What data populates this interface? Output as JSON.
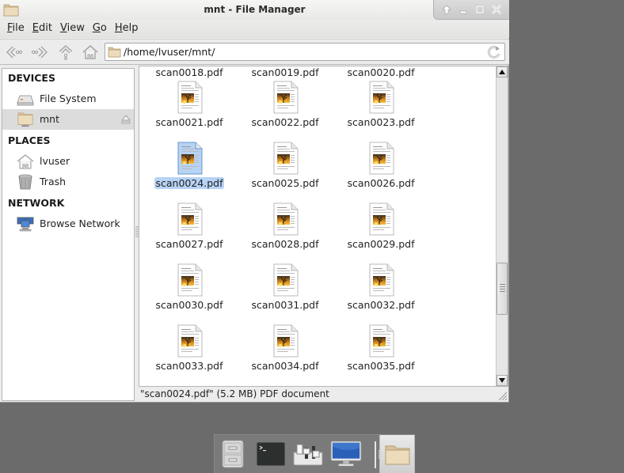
{
  "window": {
    "title": "mnt - File Manager",
    "controls": [
      "roll-up",
      "minimize",
      "maximize",
      "close"
    ]
  },
  "menubar": [
    {
      "label": "File",
      "mnemonic": "F",
      "rest": "ile"
    },
    {
      "label": "Edit",
      "mnemonic": "E",
      "rest": "dit"
    },
    {
      "label": "View",
      "mnemonic": "V",
      "rest": "iew"
    },
    {
      "label": "Go",
      "mnemonic": "G",
      "rest": "o"
    },
    {
      "label": "Help",
      "mnemonic": "H",
      "rest": "elp"
    }
  ],
  "toolbar": {
    "buttons": [
      "back",
      "forward",
      "up",
      "home"
    ],
    "location": "/home/lvuser/mnt/"
  },
  "sidebar": {
    "sections": [
      {
        "heading": "DEVICES",
        "items": [
          {
            "label": "File System",
            "icon": "harddisk-icon"
          },
          {
            "label": "mnt",
            "icon": "mounted-folder-icon",
            "selected": true,
            "eject": true
          }
        ]
      },
      {
        "heading": "PLACES",
        "items": [
          {
            "label": "lvuser",
            "icon": "home-icon"
          },
          {
            "label": "Trash",
            "icon": "trash-icon"
          }
        ]
      },
      {
        "heading": "NETWORK",
        "items": [
          {
            "label": "Browse Network",
            "icon": "network-icon"
          }
        ]
      }
    ]
  },
  "files": [
    {
      "name": "scan0018.pdf",
      "partial": true
    },
    {
      "name": "scan0019.pdf",
      "partial": true
    },
    {
      "name": "scan0020.pdf",
      "partial": true
    },
    {
      "name": "scan0021.pdf"
    },
    {
      "name": "scan0022.pdf"
    },
    {
      "name": "scan0023.pdf"
    },
    {
      "name": "scan0024.pdf",
      "selected": true
    },
    {
      "name": "scan0025.pdf"
    },
    {
      "name": "scan0026.pdf"
    },
    {
      "name": "scan0027.pdf"
    },
    {
      "name": "scan0028.pdf"
    },
    {
      "name": "scan0029.pdf"
    },
    {
      "name": "scan0030.pdf"
    },
    {
      "name": "scan0031.pdf"
    },
    {
      "name": "scan0032.pdf"
    },
    {
      "name": "scan0033.pdf"
    },
    {
      "name": "scan0034.pdf"
    },
    {
      "name": "scan0035.pdf"
    }
  ],
  "statusbar": "\"scan0024.pdf\" (5.2 MB) PDF document",
  "dock": {
    "items": [
      {
        "name": "file-cabinet-launcher"
      },
      {
        "name": "terminal-launcher"
      },
      {
        "name": "settings-manager-launcher"
      },
      {
        "name": "display-launcher"
      },
      {
        "name": "file-manager-window",
        "active": true
      }
    ]
  },
  "colors": {
    "selection": "#b7d3f5",
    "sidebar_selected": "#dcdcdc",
    "folder": "#e8d6b3"
  }
}
